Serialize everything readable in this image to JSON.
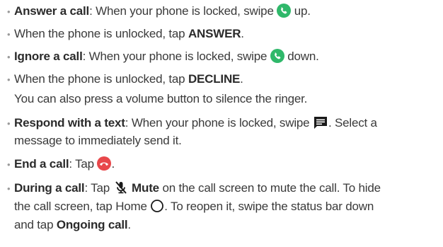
{
  "items": [
    {
      "term": "Answer a call",
      "text_before": ": When your phone is locked, swipe ",
      "icon": "phone-answer-icon",
      "text_after": " up."
    },
    {
      "text_before": "When the phone is unlocked, tap ",
      "emph": "ANSWER",
      "text_after": "."
    },
    {
      "term": "Ignore a call",
      "text_before": ": When your phone is locked, swipe ",
      "icon": "phone-answer-icon",
      "text_after": " down."
    },
    {
      "text_before": "When the phone is unlocked, tap ",
      "emph": "DECLINE",
      "text_after": ".",
      "note": "You can also press a volume button to silence the ringer."
    },
    {
      "term": "Respond with a text",
      "text_before": ": When your phone is locked, swipe ",
      "icon": "message-icon",
      "text_after": ". Select a",
      "line2": "message to immediately send it."
    },
    {
      "term": "End a call",
      "text_before": ": Tap ",
      "icon": "phone-end-icon",
      "text_after": "."
    },
    {
      "term": "During a call",
      "text_before": ": Tap ",
      "icon": "mic-mute-icon",
      "emph": "Mute",
      "text_after": " on the call screen to mute the call. To hide",
      "line2": "the call screen, tap Home ",
      "line2_icon": "home-circle-icon",
      "line2_after": ". To reopen it, swipe the status bar down",
      "line3_before": "and tap ",
      "line3_emph": "Ongoing call",
      "line3_after": "."
    }
  ],
  "bullet_char": "•",
  "colors": {
    "answer_green": "#2fb86a",
    "end_red": "#e8474a",
    "text": "#3a3a3a"
  }
}
